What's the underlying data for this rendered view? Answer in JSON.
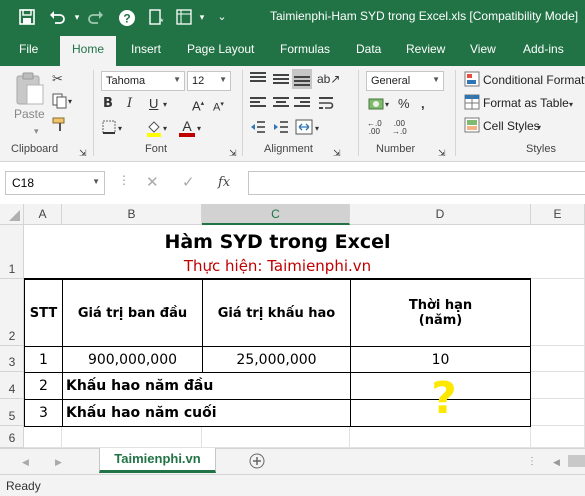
{
  "window": {
    "title": "Taimienphi-Ham SYD trong Excel.xls [Compatibility Mode]"
  },
  "tabs": [
    "File",
    "Home",
    "Insert",
    "Page Layout",
    "Formulas",
    "Data",
    "Review",
    "View",
    "Add-ins"
  ],
  "ribbon": {
    "paste_label": "Paste",
    "font_name": "Tahoma",
    "font_size": "12",
    "number_format": "General",
    "conditional_formatting": "Conditional Formatt",
    "format_as_table": "Format as Table",
    "cell_styles": "Cell Styles",
    "groups": {
      "clipboard": "Clipboard",
      "font": "Font",
      "alignment": "Alignment",
      "number": "Number",
      "styles": "Styles"
    }
  },
  "formula_bar": {
    "name_box": "C18",
    "formula": ""
  },
  "columns": [
    "A",
    "B",
    "C",
    "D",
    "E"
  ],
  "rows": [
    "1",
    "2",
    "3",
    "4",
    "5",
    "6"
  ],
  "sheet": {
    "title": "Hàm SYD trong Excel",
    "subtitle": "Thực hiện: Taimienphi.vn",
    "header_stt": "STT",
    "header_initial": "Giá trị ban đầu",
    "header_depreciation": "Giá trị khấu hao",
    "header_term_1": "Thời hạn",
    "header_term_2": "(năm)",
    "row3": {
      "stt": "1",
      "initial": "900,000,000",
      "depreciation": "25,000,000",
      "term": "10"
    },
    "row4": {
      "stt": "2",
      "label": "Khấu hao năm đầu"
    },
    "row5": {
      "stt": "3",
      "label": "Khấu hao năm cuối"
    },
    "question_mark": "?"
  },
  "sheet_tab": "Taimienphi.vn",
  "status": "Ready",
  "colors": {
    "excel_green": "#217346",
    "subtitle_red": "#c00000",
    "question_yellow": "#ffe800"
  }
}
